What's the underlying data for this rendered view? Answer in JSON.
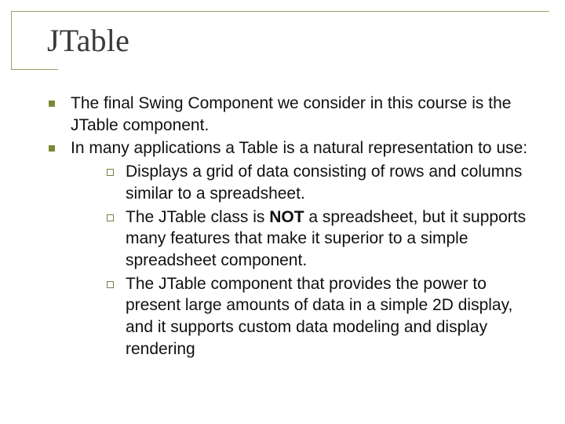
{
  "title": "JTable",
  "bullets": {
    "b1": "The final Swing Component we consider in this course is the JTable component.",
    "b2": "In many applications a Table is a natural representation to use:",
    "sub": {
      "s1": "Displays a grid of data consisting of rows and columns similar to a spreadsheet.",
      "s2a": "The JTable class is ",
      "s2_not": "NOT",
      "s2b": " a spreadsheet, but it supports many features that make it superior to a simple spreadsheet component.",
      "s3": "The JTable component that provides the power to present large amounts of data in a simple 2D display, and it supports custom data modeling and display rendering"
    }
  }
}
